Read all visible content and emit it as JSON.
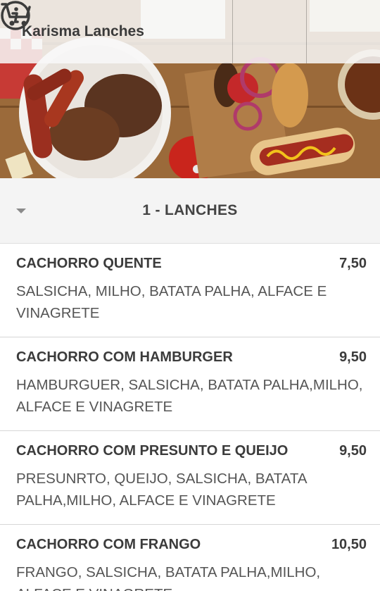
{
  "header": {
    "title": "Karisma Lanches",
    "info_icon": "info-circle-icon",
    "cart_icon": "shopping-cart-icon"
  },
  "category": {
    "title": "1 - LANCHES",
    "caret_icon": "caret-down-icon"
  },
  "items": [
    {
      "name": "CACHORRO QUENTE",
      "price": "7,50",
      "description": "SALSICHA, MILHO, BATATA PALHA, ALFACE E VINAGRETE"
    },
    {
      "name": "CACHORRO COM HAMBURGER",
      "price": "9,50",
      "description": "HAMBURGUER, SALSICHA, BATATA PALHA,MILHO, ALFACE E VINAGRETE"
    },
    {
      "name": "CACHORRO COM PRESUNTO E QUEIJO",
      "price": "9,50",
      "description": "PRESUNRTO, QUEIJO, SALSICHA, BATATA PALHA,MILHO, ALFACE E VINAGRETE"
    },
    {
      "name": "CACHORRO COM FRANGO",
      "price": "10,50",
      "description": "FRANGO, SALSICHA, BATATA PALHA,MILHO, ALFACE E VINAGRETE"
    }
  ],
  "colors": {
    "header_bg": "#f8f8f8",
    "category_bg": "#f4f4f4",
    "text": "#3b3b3b"
  }
}
